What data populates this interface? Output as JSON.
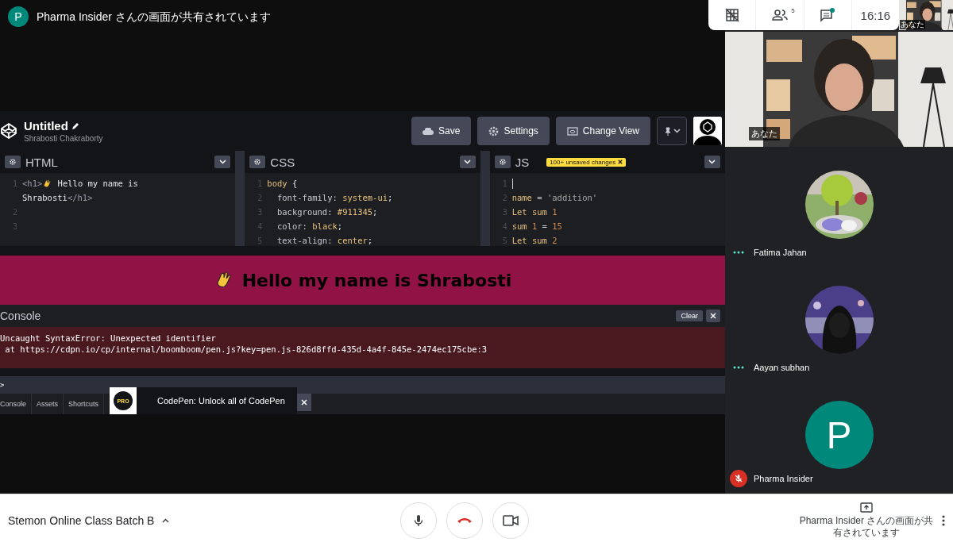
{
  "share_banner": {
    "avatar": "P",
    "text": "Pharma Insider さんの画面が共有されています"
  },
  "codepen": {
    "title": "Untitled",
    "author": "Shrabosti Chakraborty",
    "buttons": [
      {
        "label": "Save",
        "kind": "cloud"
      },
      {
        "label": "Settings",
        "kind": "gear"
      },
      {
        "label": "Change View",
        "kind": "view"
      }
    ],
    "panes": [
      {
        "title": "HTML",
        "lines": [
          {
            "number": "1",
            "tokens": [
              {
                "kind": "tag",
                "text": "<h1>"
              },
              {
                "kind": "wave"
              },
              {
                "kind": "plain",
                "text": " Hello my name is"
              }
            ]
          },
          {
            "tokens": [
              {
                "kind": "plain",
                "text": "Shrabosti"
              },
              {
                "kind": "tag",
                "text": "</h1>"
              }
            ]
          },
          {
            "number": "2"
          },
          {
            "number": "3"
          }
        ]
      },
      {
        "title": "CSS",
        "lines": [
          {
            "number": "1",
            "tokens": [
              {
                "kind": "value",
                "text": "body"
              },
              {
                "kind": "plain",
                "text": " {"
              }
            ]
          },
          {
            "number": "2",
            "tokens": [
              {
                "kind": "property",
                "text": "  font-family: "
              },
              {
                "kind": "value",
                "text": "system-ui"
              },
              {
                "kind": "plain",
                "text": ";"
              }
            ]
          },
          {
            "number": "3",
            "tokens": [
              {
                "kind": "property",
                "text": "  background: "
              },
              {
                "kind": "value",
                "text": "#911345"
              },
              {
                "kind": "plain",
                "text": ";"
              }
            ]
          },
          {
            "number": "4",
            "tokens": [
              {
                "kind": "property",
                "text": "  color: "
              },
              {
                "kind": "value",
                "text": "black"
              },
              {
                "kind": "plain",
                "text": ";"
              }
            ]
          },
          {
            "number": "5",
            "tokens": [
              {
                "kind": "property",
                "text": "  text-align: "
              },
              {
                "kind": "value",
                "text": "center"
              },
              {
                "kind": "plain",
                "text": ";"
              }
            ]
          }
        ]
      },
      {
        "title": "JS",
        "badge": "100+ unsaved changes",
        "lines": [
          {
            "number": "1",
            "tokens": [
              {
                "kind": "cursor"
              }
            ]
          },
          {
            "number": "2",
            "tokens": [
              {
                "kind": "value",
                "text": "name"
              },
              {
                "kind": "property",
                "text": " = "
              },
              {
                "kind": "string",
                "text": "'addition'"
              }
            ]
          },
          {
            "number": "3",
            "tokens": [
              {
                "kind": "value",
                "text": "Let sum "
              },
              {
                "kind": "number",
                "text": "1"
              }
            ]
          },
          {
            "number": "4",
            "tokens": [
              {
                "kind": "value",
                "text": "sum "
              },
              {
                "kind": "number",
                "text": "1"
              },
              {
                "kind": "property",
                "text": " = "
              },
              {
                "kind": "number",
                "text": "15"
              }
            ]
          },
          {
            "number": "5",
            "tokens": [
              {
                "kind": "value",
                "text": "Let sum "
              },
              {
                "kind": "number",
                "text": "2"
              }
            ]
          }
        ]
      }
    ],
    "preview": {
      "heading": "Hello my name is Shrabosti"
    },
    "console": {
      "title": "Console",
      "clear": "Clear",
      "errors": [
        "Uncaught SyntaxError: Unexpected identifier",
        " at https://cdpn.io/cp/internal/boomboom/pen.js?key=pen.js-826d8ffd-435d-4a4f-845e-2474ec175cbe:3"
      ],
      "prompt": ">"
    },
    "tabs": [
      "Console",
      "Assets",
      "Shortcuts"
    ],
    "promo": {
      "badge": "PRO",
      "text": "CodePen: Unlock all of CodePen"
    }
  },
  "meet_toolbar": {
    "participant_count": "5",
    "chat_unread": true,
    "time": "16:16"
  },
  "self_view": {
    "thumbnail_label": "あなた",
    "label": "あなた"
  },
  "participants": [
    {
      "name": "Fatima Jahan",
      "kind": "garden",
      "muted": false
    },
    {
      "name": "Aayan subhan",
      "kind": "hooded",
      "muted": false
    },
    {
      "name": "Pharma Insider",
      "kind": "letter",
      "letter": "P",
      "muted": true
    }
  ],
  "call_bar": {
    "meeting_name": "Stemon Online Class Batch B",
    "presenting_text": "Pharma Insider さんの画面が共有されています"
  }
}
